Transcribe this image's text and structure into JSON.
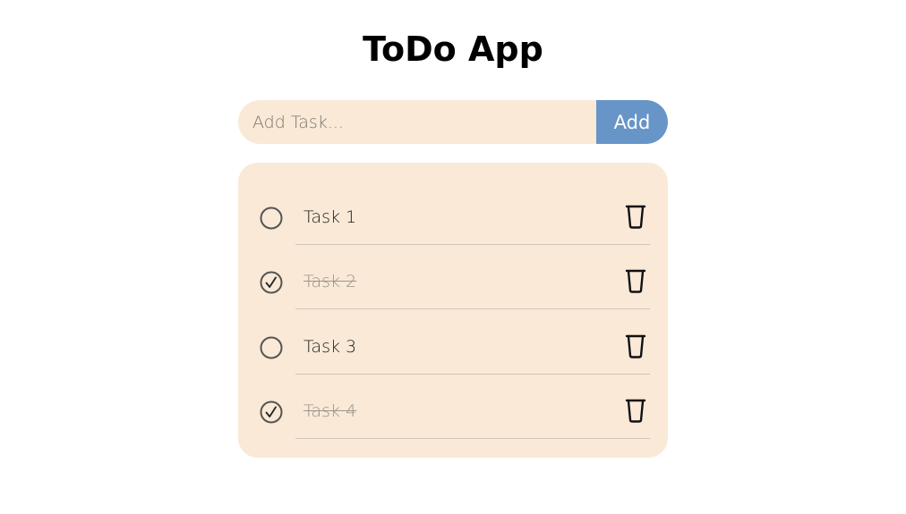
{
  "app": {
    "title": "ToDo App"
  },
  "add_form": {
    "placeholder": "Add Task...",
    "value": "",
    "button_label": "Add"
  },
  "tasks": [
    {
      "label": "Task 1",
      "completed": false
    },
    {
      "label": "Task 2",
      "completed": true
    },
    {
      "label": "Task 3",
      "completed": false
    },
    {
      "label": "Task 4",
      "completed": true
    }
  ],
  "colors": {
    "accent": "#6895c8",
    "panel": "#f9e9d6",
    "done_text": "#9a948c"
  },
  "icons": {
    "unchecked": "circle-icon",
    "checked": "check-circle-icon",
    "delete": "trash-icon"
  }
}
